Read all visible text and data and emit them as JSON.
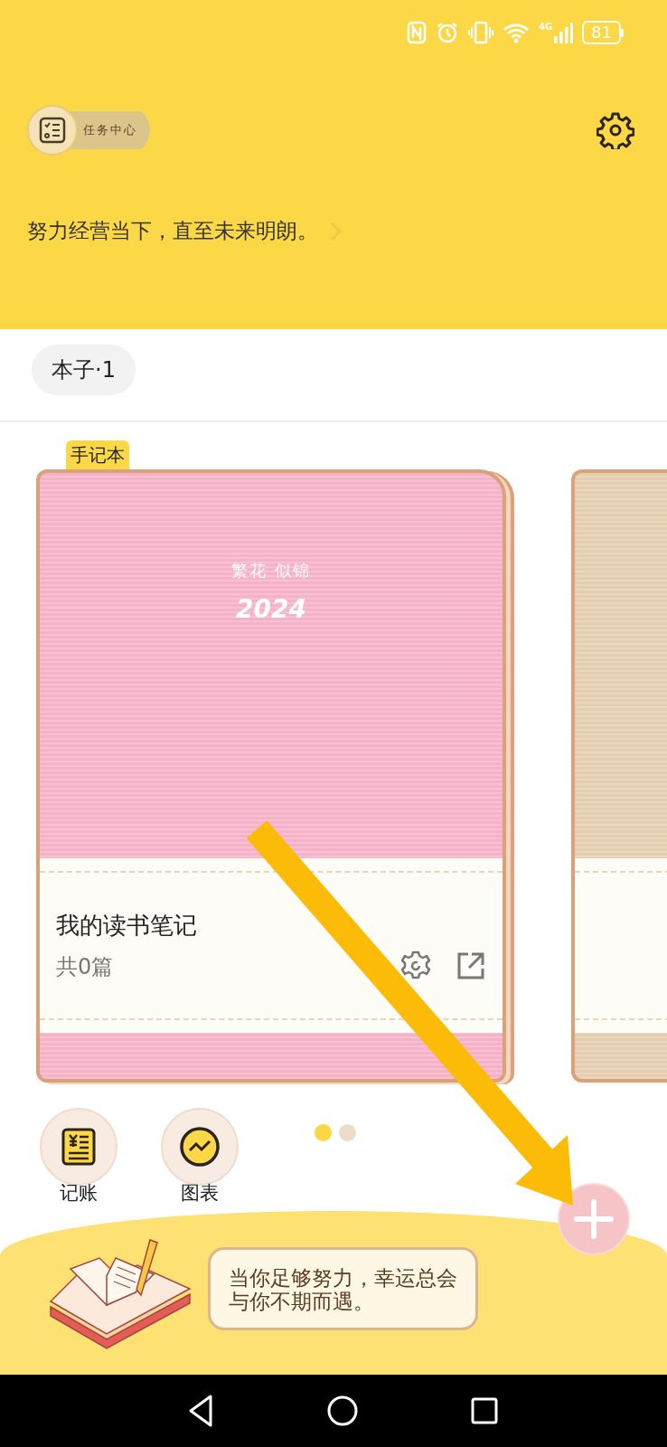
{
  "status_bar": {
    "network": "4G",
    "battery": "81"
  },
  "header": {
    "task_center": "任务中心",
    "motto": "努力经营当下，直至未来明朗。"
  },
  "notebook_tab": {
    "label": "本子·1"
  },
  "notebooks": [
    {
      "tag": "手记本",
      "cover_title": "繁花 似锦",
      "cover_year": "2024",
      "title": "我的读书笔记",
      "count": "共0篇",
      "color": "#f9b6cc"
    },
    {
      "color": "#e8d2b4"
    }
  ],
  "page_dots": [
    {
      "selected": true
    },
    {
      "selected": false
    }
  ],
  "shortcuts": [
    {
      "label": "记账",
      "kind": "ledger"
    },
    {
      "label": "图表",
      "kind": "chart"
    }
  ],
  "quote": "当你足够努力，幸运总会与你不期而遇。"
}
